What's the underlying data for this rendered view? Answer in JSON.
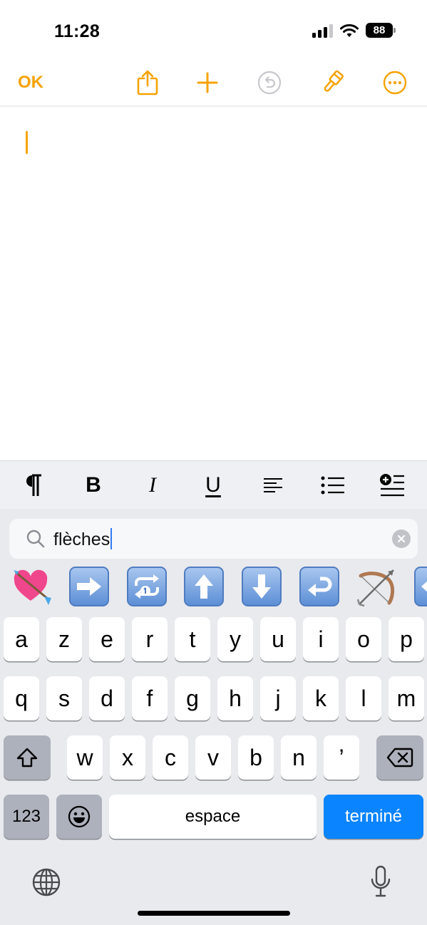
{
  "status": {
    "time": "11:28",
    "battery": "88"
  },
  "toolbar": {
    "ok_label": "OK",
    "icons": [
      "share-icon",
      "add-icon",
      "undo-icon",
      "markup-brush-icon",
      "more-icon"
    ],
    "accent": "#f5a300"
  },
  "note": {
    "text": ""
  },
  "format_bar": {
    "items": [
      "paragraph-icon",
      "bold",
      "italic",
      "underline",
      "align-left-icon",
      "bulleted-list-icon",
      "indent-icon"
    ],
    "bold_label": "B",
    "italic_label": "I",
    "underline_label": "U"
  },
  "emoji_search": {
    "query": "flèches",
    "results": [
      "heart-with-arrow",
      "right-arrow",
      "repeat-single-button",
      "up-arrow",
      "down-arrow",
      "right-arrow-curving-left",
      "bow-and-arrow",
      "left-right-arrow"
    ]
  },
  "keyboard": {
    "row1": [
      "a",
      "z",
      "e",
      "r",
      "t",
      "y",
      "u",
      "i",
      "o",
      "p"
    ],
    "row2": [
      "q",
      "s",
      "d",
      "f",
      "g",
      "h",
      "j",
      "k",
      "l",
      "m"
    ],
    "row3": [
      "w",
      "x",
      "c",
      "v",
      "b",
      "n",
      "’"
    ],
    "numbers_label": "123",
    "space_label": "espace",
    "done_label": "terminé",
    "done_color": "#0a84ff"
  }
}
